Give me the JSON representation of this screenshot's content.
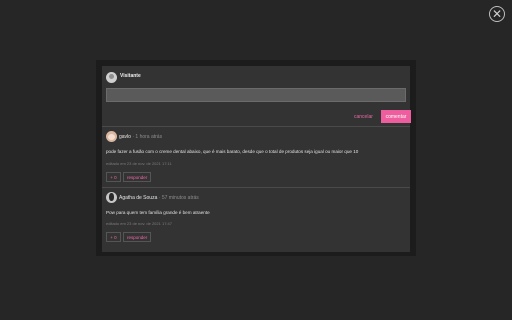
{
  "overlay": {
    "close_symbol": "✕"
  },
  "composer": {
    "username": "Visitante",
    "input_value": "",
    "cancel_label": "cancelar",
    "submit_label": "comentar"
  },
  "comments": [
    {
      "author": "gavlo",
      "time": "· 1 hora atrás",
      "text": "pode fazer a fusão com o creme dental abaixo, que é mais barato, desde que o total de produtos seja igual ou maior que 10",
      "meta": "editado em 23 de nov. de 2021 17:11",
      "votes": "+ 0",
      "reply_label": "responder",
      "avatar_icon": "cat-avatar-icon"
    },
    {
      "author": "Agatha de Souza",
      "time": "· 57 minutos atrás",
      "text": "Pow para quem tem família grande é bem atraente",
      "meta": "editado em 23 de nov. de 2021 17:47",
      "votes": "+ 0",
      "reply_label": "responder",
      "avatar_icon": "woman-avatar-icon"
    }
  ],
  "colors": {
    "accent": "#ee5e9e",
    "panel": "#333333",
    "backdrop": "#262626"
  }
}
